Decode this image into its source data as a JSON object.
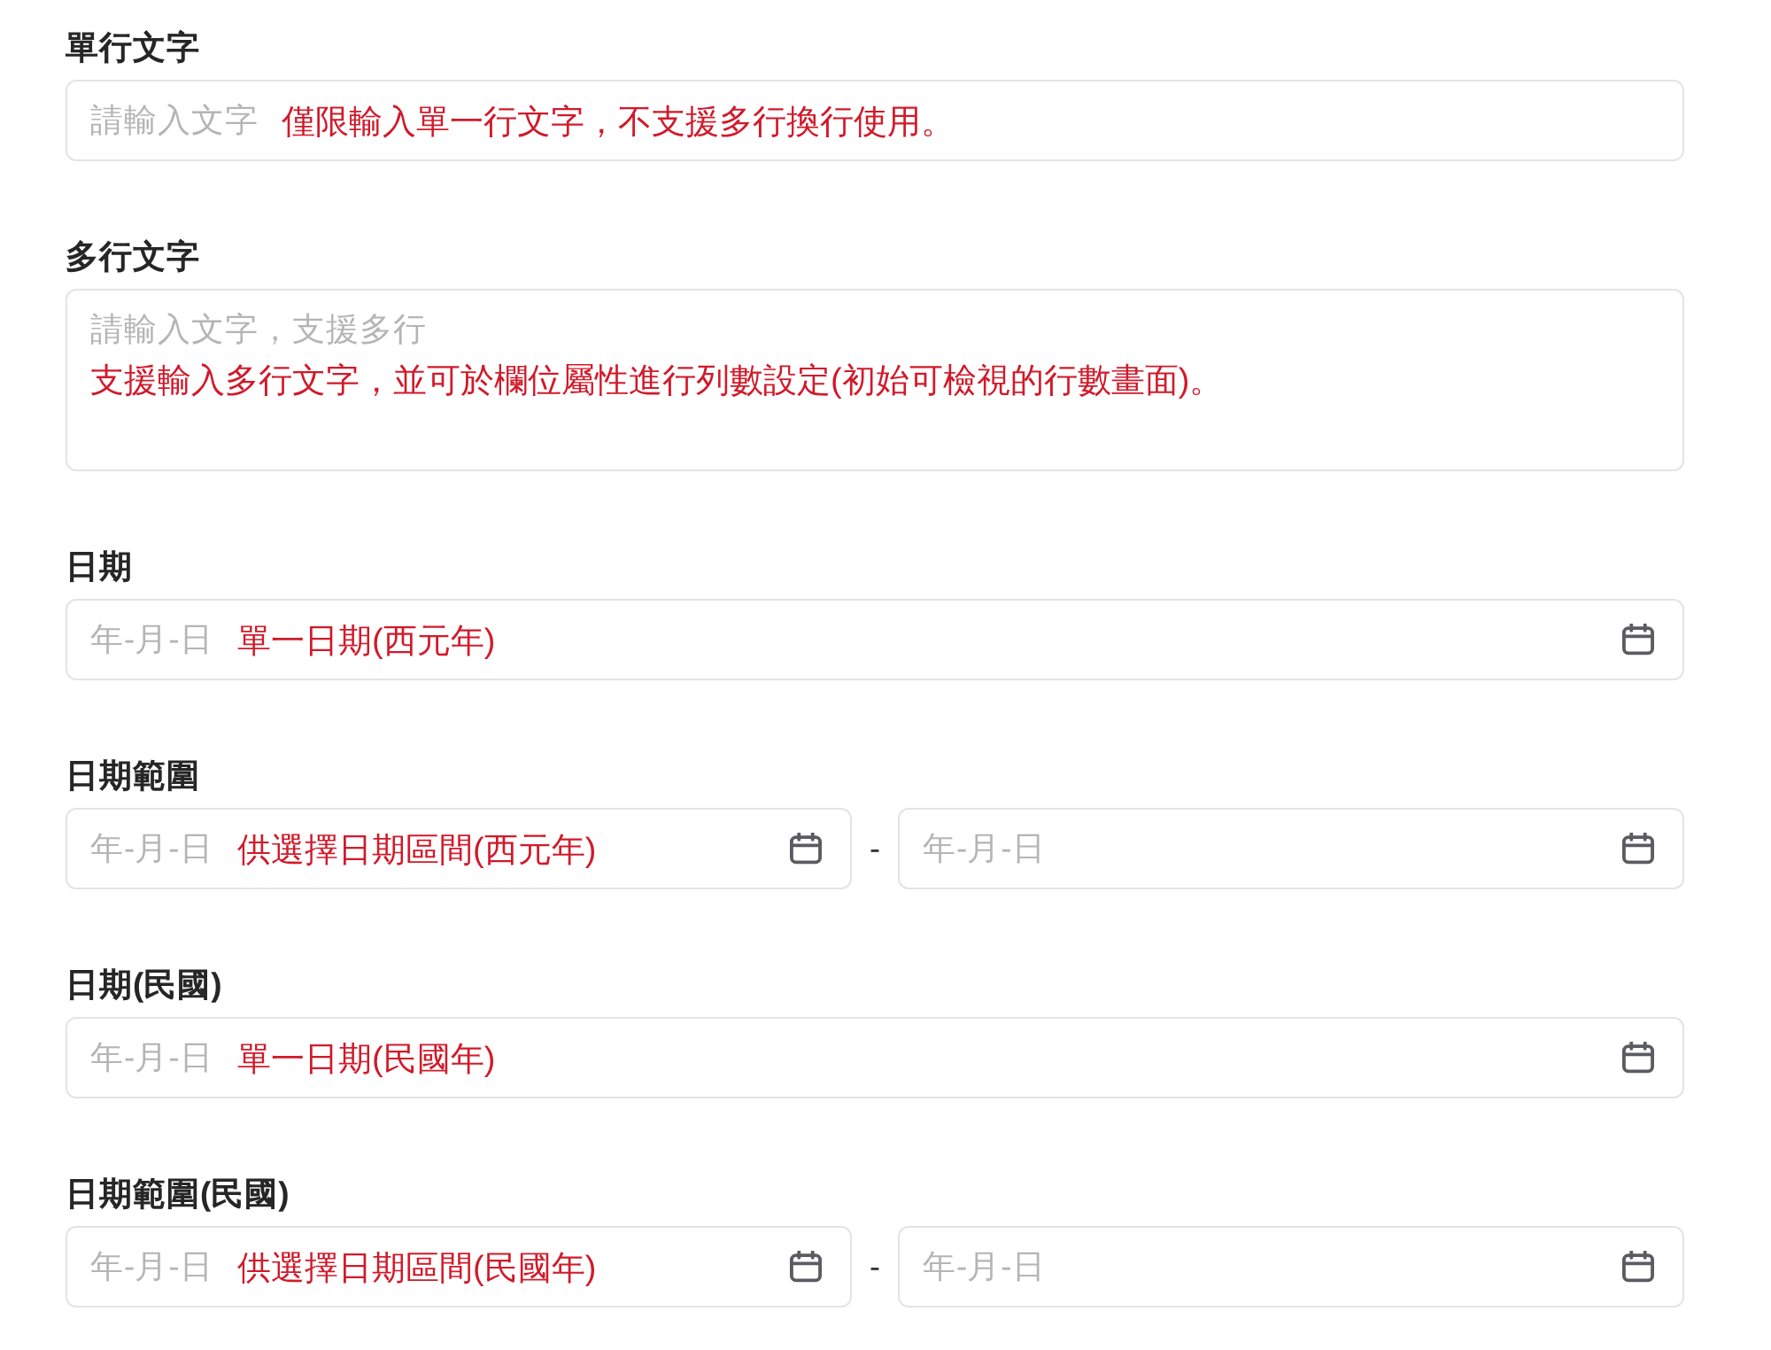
{
  "fields": [
    {
      "kind": "text",
      "label": "單行文字",
      "placeholder": "請輸入文字",
      "note": "僅限輸入單一行文字，不支援多行換行使用。"
    },
    {
      "kind": "textarea",
      "label": "多行文字",
      "placeholder": "請輸入文字，支援多行",
      "note": "支援輸入多行文字，並可於欄位屬性進行列數設定(初始可檢視的行數畫面)。"
    },
    {
      "kind": "date",
      "label": "日期",
      "placeholder": "年-月-日",
      "note": "單一日期(西元年)"
    },
    {
      "kind": "date_range",
      "label": "日期範圍",
      "start": {
        "placeholder": "年-月-日",
        "note": "供選擇日期區間(西元年)"
      },
      "separator": "-",
      "end": {
        "placeholder": "年-月-日"
      }
    },
    {
      "kind": "date",
      "label": "日期(民國)",
      "placeholder": "年-月-日",
      "note": "單一日期(民國年)"
    },
    {
      "kind": "date_range",
      "label": "日期範圍(民國)",
      "start": {
        "placeholder": "年-月-日",
        "note": "供選擇日期區間(民國年)"
      },
      "separator": "-",
      "end": {
        "placeholder": "年-月-日"
      }
    }
  ]
}
